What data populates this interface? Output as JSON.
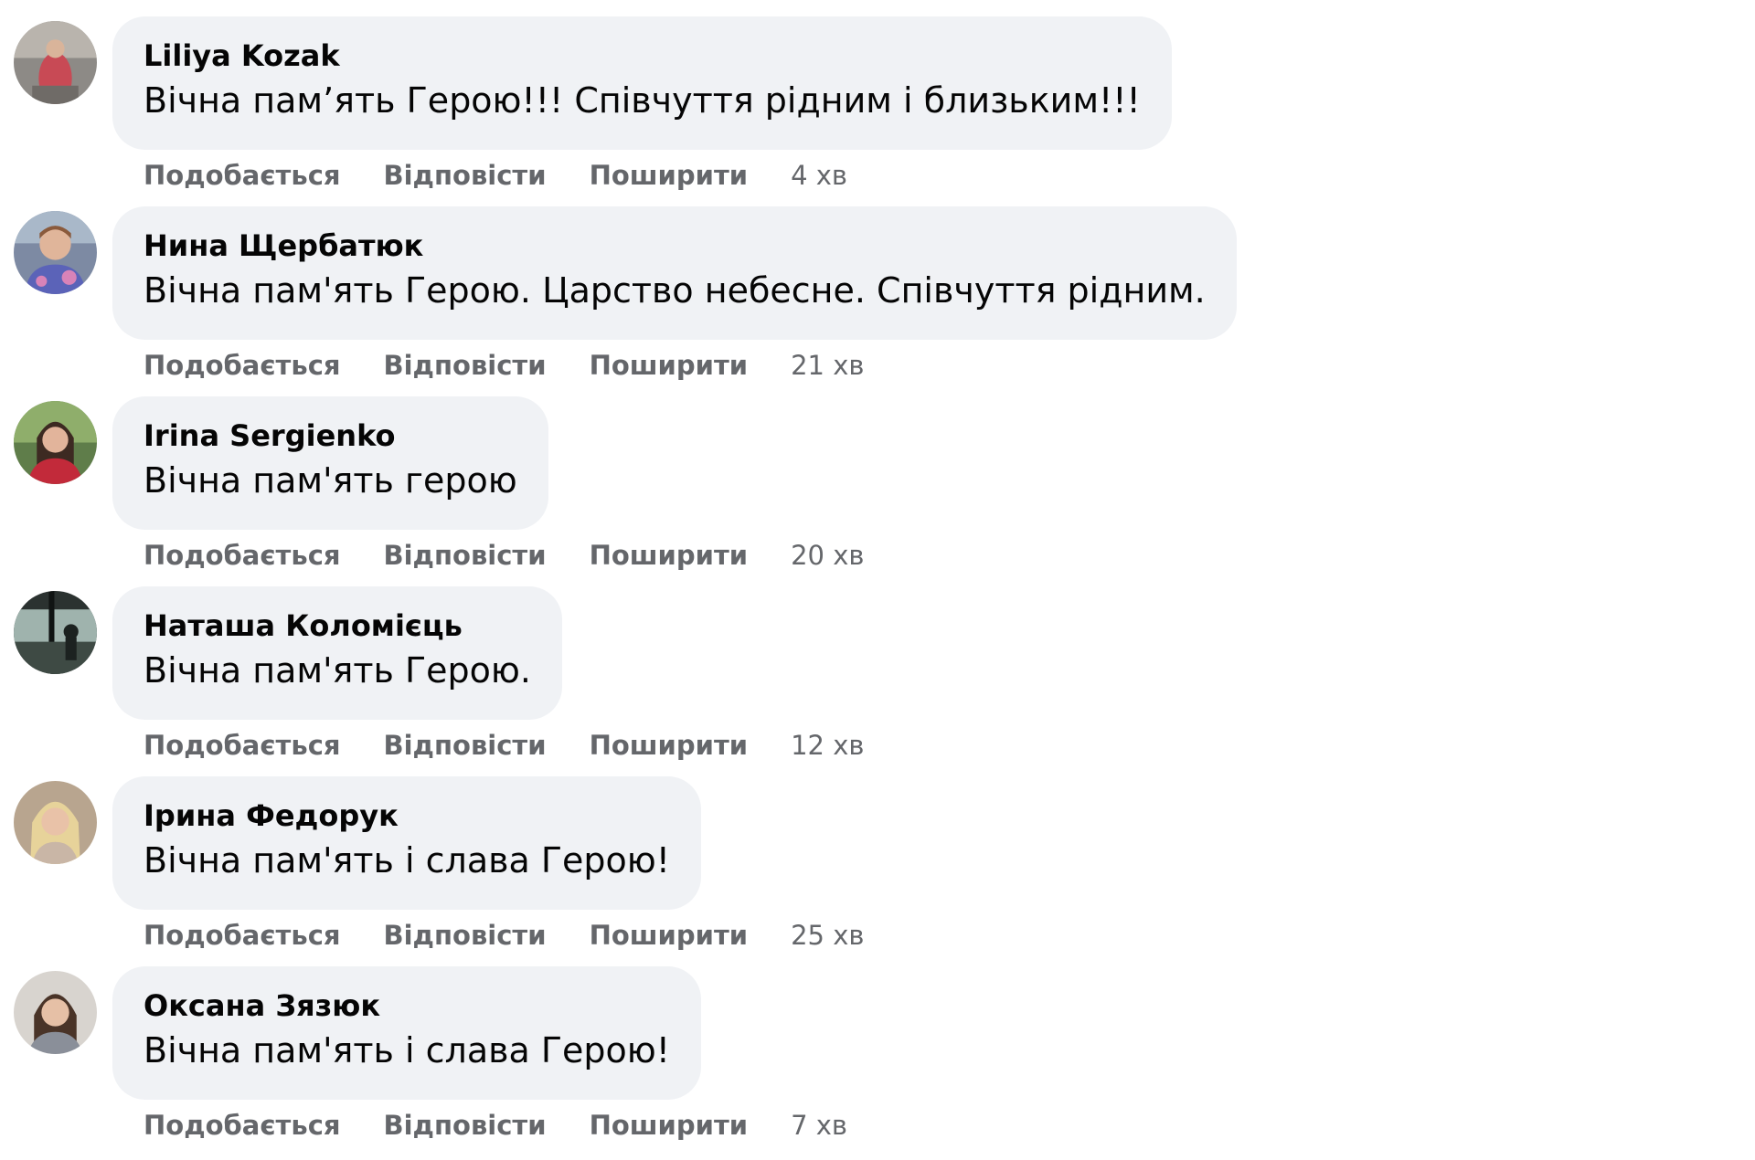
{
  "labels": {
    "like": "Подобається",
    "reply": "Відповісти",
    "share": "Поширити"
  },
  "comments": [
    {
      "author": "Liliya Kozak",
      "text": "Вічна пам’ять Герою!!! Співчуття рідним і близьким!!!",
      "time": "4 хв"
    },
    {
      "author": "Нина Щербатюк",
      "text": "Вічна пам'ять Герою. Царство небесне. Співчуття рідним.",
      "time": "21 хв"
    },
    {
      "author": "Irina Sergienko",
      "text": "Вічна пам'ять герою",
      "time": "20 хв"
    },
    {
      "author": "Наташа Коломієць",
      "text": "Вічна пам'ять Герою.",
      "time": "12 хв"
    },
    {
      "author": "Ірина Федорук",
      "text": "Вічна пам'ять і слава Герою!",
      "time": "25 хв"
    },
    {
      "author": "Оксана Зязюк",
      "text": "Вічна пам'ять і слава Герою!",
      "time": "7 хв"
    }
  ],
  "colors": {
    "bubble_background": "#f0f2f5",
    "author_text": "#050505",
    "comment_text": "#050505",
    "action_text": "#65676b"
  }
}
